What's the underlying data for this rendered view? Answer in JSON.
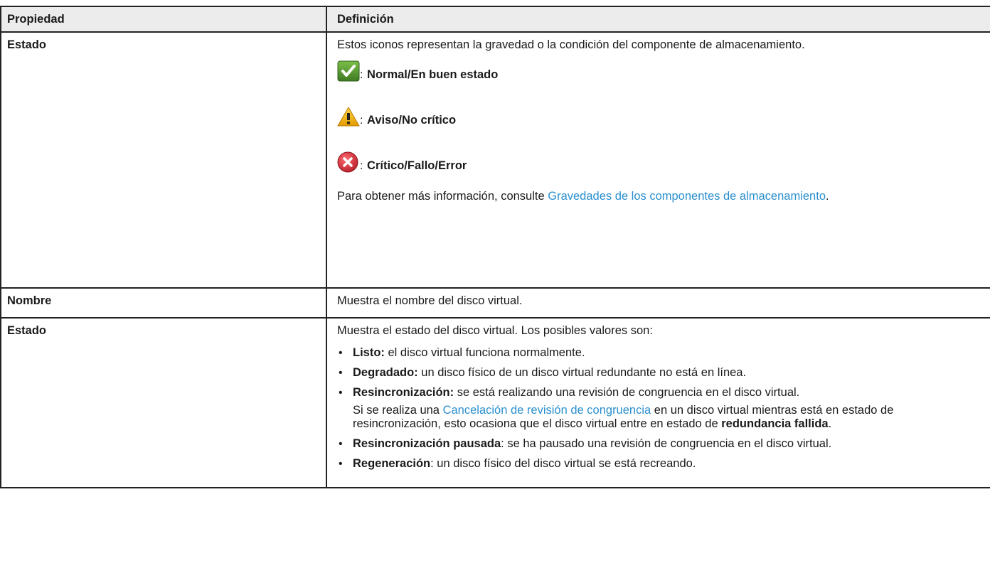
{
  "table": {
    "header": {
      "col1": "Propiedad",
      "col2": "Definición"
    },
    "rows": [
      {
        "property": "Estado",
        "intro": "Estos iconos representan la gravedad o la condición del componente de almacenamiento.",
        "severities": [
          {
            "icon": "check-icon",
            "color": "#4a8a2a",
            "label": "Normal/En buen estado"
          },
          {
            "icon": "warning-icon",
            "color": "#e0a800",
            "label": "Aviso/No crítico"
          },
          {
            "icon": "error-icon",
            "color": "#c9303a",
            "label": "Crítico/Fallo/Error"
          }
        ],
        "more_info_prefix": "Para obtener más información, consulte ",
        "more_info_link": "Gravedades de los componentes de almacenamiento",
        "more_info_suffix": "."
      },
      {
        "property": "Nombre",
        "definition": "Muestra el nombre del disco virtual."
      },
      {
        "property": "Estado",
        "intro": "Muestra el estado del disco virtual. Los posibles valores son:",
        "states": [
          {
            "term": "Listo:",
            "text": " el disco virtual funciona normalmente."
          },
          {
            "term": "Degradado:",
            "text": " un disco físico de un disco virtual redundante no está en línea."
          },
          {
            "term": "Resincronización:",
            "text": " se está realizando una revisión de congruencia en el disco virtual.",
            "note_prefix": "Si se realiza una ",
            "note_link": "Cancelación de revisión de congruencia",
            "note_middle": " en un disco virtual mientras está en estado de resincronización, esto ocasiona que el disco virtual entre en estado de ",
            "note_bold": "redundancia fallida",
            "note_suffix": "."
          },
          {
            "term": "Resincronización pausada",
            "text": ": se ha pausado una revisión de congruencia en el disco virtual."
          },
          {
            "term": "Regeneración",
            "text": ": un disco físico del disco virtual se está recreando."
          }
        ]
      }
    ]
  },
  "bullet": "•"
}
